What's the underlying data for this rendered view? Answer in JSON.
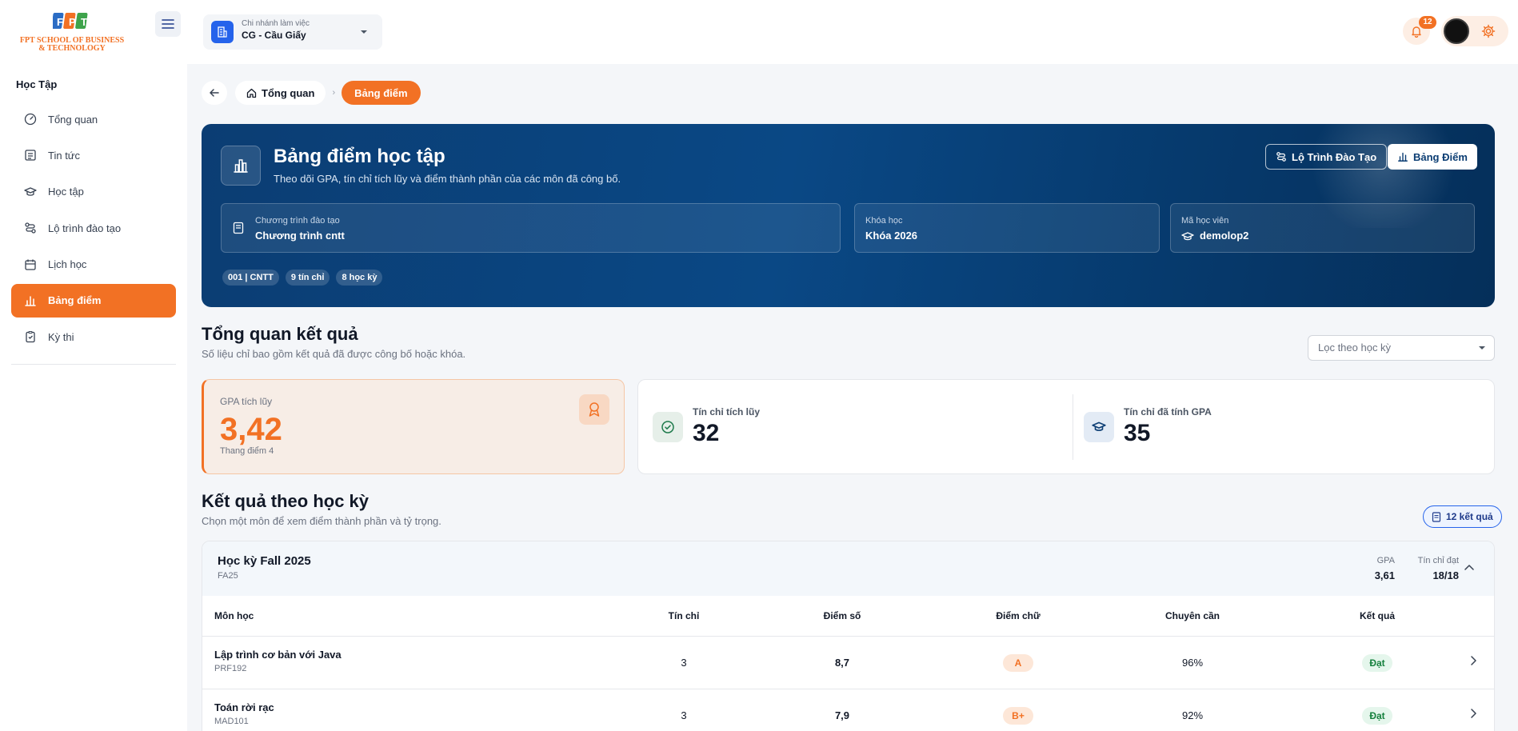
{
  "brand": {
    "logo_text": "FPT SCHOOL OF BUSINESS & TECHNOLOGY",
    "logo_letters": "FPT",
    "accent": "#f27124"
  },
  "sidebar": {
    "section": "Học Tập",
    "items": [
      {
        "label": "Tổng quan",
        "icon": "dashboard-icon"
      },
      {
        "label": "Tin tức",
        "icon": "news-icon"
      },
      {
        "label": "Học tập",
        "icon": "graduation-cap-icon"
      },
      {
        "label": "Lộ trình đào tạo",
        "icon": "route-icon"
      },
      {
        "label": "Lịch học",
        "icon": "calendar-icon"
      },
      {
        "label": "Bảng điểm",
        "icon": "bar-chart-icon",
        "active": true
      },
      {
        "label": "Kỳ thi",
        "icon": "clipboard-check-icon"
      }
    ]
  },
  "topbar": {
    "branch_label": "Chi nhánh làm việc",
    "branch_value": "CG - Cầu Giấy",
    "notification_count": "12"
  },
  "breadcrumb": {
    "home": "Tổng quan",
    "current": "Bảng điểm"
  },
  "hero": {
    "title": "Bảng điểm học tập",
    "subtitle": "Theo dõi GPA, tín chỉ tích lũy và điểm thành phần của các môn đã công bố.",
    "btn_roadmap": "Lộ Trình Đào Tạo",
    "btn_grades": "Bảng Điểm",
    "program_label": "Chương trình đào tạo",
    "program_value": "Chương trình cntt",
    "course_label": "Khóa học",
    "course_value": "Khóa 2026",
    "student_label": "Mã học viên",
    "student_value": "demolop2",
    "chips": [
      "001 | CNTT",
      "9 tín chỉ",
      "8 học kỳ"
    ]
  },
  "overview": {
    "title": "Tổng quan kết quả",
    "subtitle": "Số liệu chỉ bao gồm kết quả đã được công bố hoặc khóa.",
    "filter_placeholder": "Lọc theo học kỳ",
    "gpa_label": "GPA tích lũy",
    "gpa_value": "3,42",
    "gpa_scale": "Thang điểm 4",
    "credits_label": "Tín chỉ tích lũy",
    "credits_value": "32",
    "gpa_credits_label": "Tín chỉ đã tính GPA",
    "gpa_credits_value": "35"
  },
  "results": {
    "title": "Kết quả theo học kỳ",
    "subtitle": "Chọn một môn để xem điểm thành phần và tỷ trọng.",
    "count": "12 kết quả",
    "term": {
      "name": "Học kỳ Fall 2025",
      "code": "FA25",
      "gpa_label": "GPA",
      "gpa_value": "3,61",
      "credits_label": "Tín chỉ đạt",
      "credits_value": "18/18"
    },
    "columns": [
      "Môn học",
      "Tín chỉ",
      "Điểm số",
      "Điểm chữ",
      "Chuyên cần",
      "Kết quả"
    ],
    "rows": [
      {
        "name": "Lập trình cơ bản với Java",
        "code": "PRF192",
        "credits": "3",
        "score": "8,7",
        "letter": "A",
        "attendance": "96%",
        "result": "Đạt"
      },
      {
        "name": "Toán rời rạc",
        "code": "MAD101",
        "credits": "3",
        "score": "7,9",
        "letter": "B+",
        "attendance": "92%",
        "result": "Đạt"
      }
    ]
  }
}
